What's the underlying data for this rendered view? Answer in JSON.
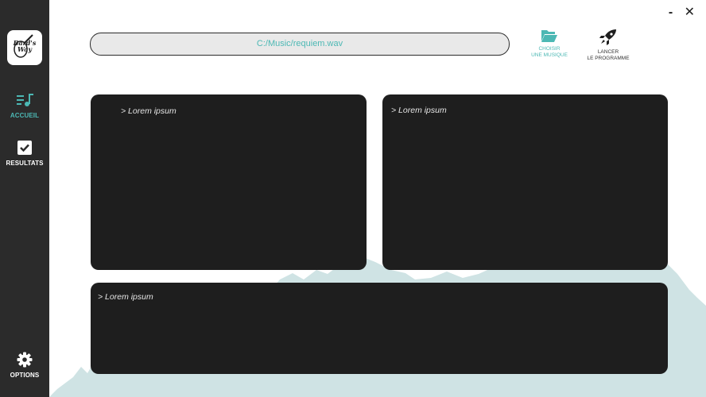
{
  "app": {
    "logo_text": "Bard's\nWay"
  },
  "sidebar": {
    "items": [
      {
        "label": "ACCUEIL",
        "icon": "music-list-icon",
        "active": true
      },
      {
        "label": "RESULTATS",
        "icon": "checkbox-icon",
        "active": false
      },
      {
        "label": "OPTIONS",
        "icon": "gear-icon",
        "active": false
      }
    ]
  },
  "window": {
    "minimize_label": "-",
    "close_label": "✕"
  },
  "toolbar": {
    "file_path": "C:/Music/requiem.wav",
    "choose_label": "CHOISIR\nUNE MUSIQUE",
    "launch_label": "LANCER\nLE PROGRAMME"
  },
  "panels": [
    {
      "text": "> Lorem ipsum"
    },
    {
      "text": "> Lorem ipsum"
    },
    {
      "text": "> Lorem ipsum"
    }
  ],
  "colors": {
    "accent": "#4cb8b4",
    "sidebar_bg": "#2b2b2b",
    "panel_bg": "#1e1e1e",
    "mountain": "#cfe3e4"
  }
}
